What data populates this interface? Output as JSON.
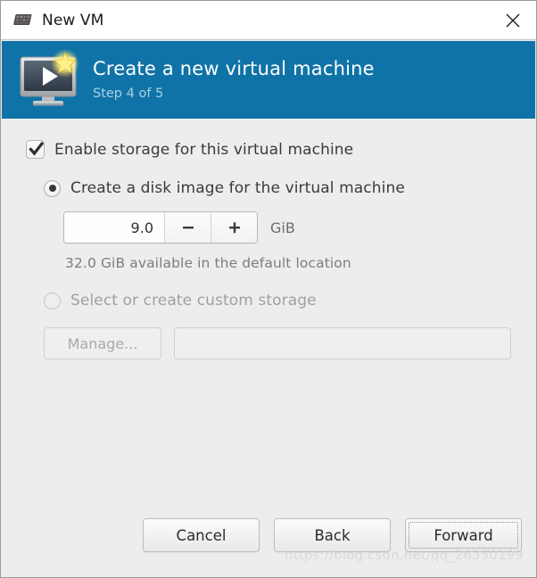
{
  "window": {
    "title": "New VM",
    "title_icon": "vm-small-icon",
    "close_icon": "close-icon"
  },
  "banner": {
    "icon": "virtual-machine-icon",
    "title": "Create a new virtual machine",
    "subtitle": "Step 4 of 5",
    "background_color": "#1073a8",
    "title_color": "#ffffff",
    "subtitle_color": "#a9cfe3"
  },
  "form": {
    "enable_storage": {
      "label": "Enable storage for this virtual machine",
      "checked": true,
      "icon": "checkmark-icon"
    },
    "create_disk_image": {
      "label": "Create a disk image for the virtual machine",
      "selected": true
    },
    "disk_size": {
      "value": "9.0",
      "unit": "GiB",
      "decrement_icon": "minus-icon",
      "increment_icon": "plus-icon"
    },
    "availability_hint": "32.0 GiB available in the default location",
    "custom_storage": {
      "label": "Select or create custom storage",
      "selected": false,
      "enabled": false
    },
    "manage_button": {
      "label": "Manage...",
      "enabled": false
    },
    "storage_path": {
      "value": "",
      "placeholder": "",
      "enabled": false
    }
  },
  "footer": {
    "cancel_label": "Cancel",
    "back_label": "Back",
    "forward_label": "Forward",
    "focused_button": "Forward"
  },
  "watermark": "https://blog.csdn.net/qq_26350199"
}
